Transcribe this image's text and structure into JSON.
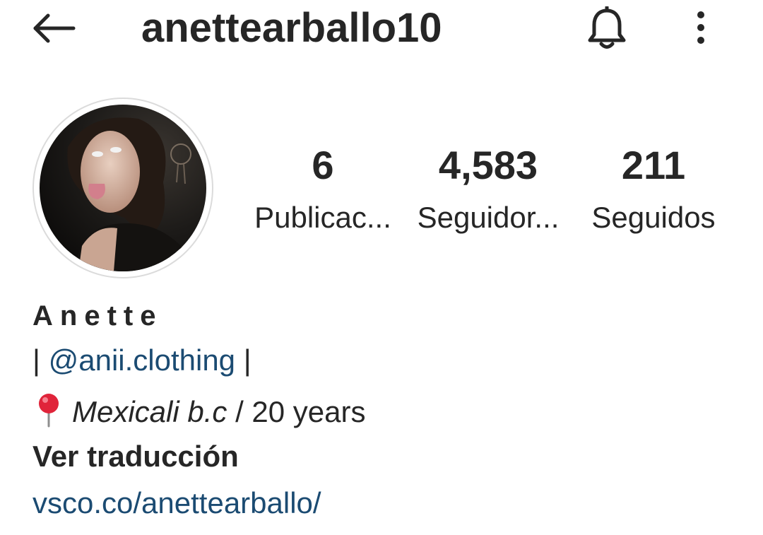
{
  "header": {
    "username": "anettearballo10",
    "back_icon": "arrow-left-icon",
    "notifications_icon": "bell-icon",
    "menu_icon": "more-vertical-icon"
  },
  "profile": {
    "avatar_icon": "profile-photo",
    "stats": [
      {
        "value": "6",
        "label": "Publicac..."
      },
      {
        "value": "4,583",
        "label": "Seguidor..."
      },
      {
        "value": "211",
        "label": "Seguidos"
      }
    ],
    "full_name": "Anette",
    "bio": {
      "line1_prefix": "| ",
      "mention": "@anii.clothing",
      "line1_suffix": " |",
      "pin_icon": "round-pushpin-icon",
      "location": "Mexicali b.c",
      "location_suffix": " / 20 years"
    },
    "translate_label": "Ver traducción",
    "website": "vsco.co/anettearballo/"
  },
  "colors": {
    "text": "#262626",
    "link": "#1b4b72",
    "avatar_border": "#dbdbdb"
  }
}
